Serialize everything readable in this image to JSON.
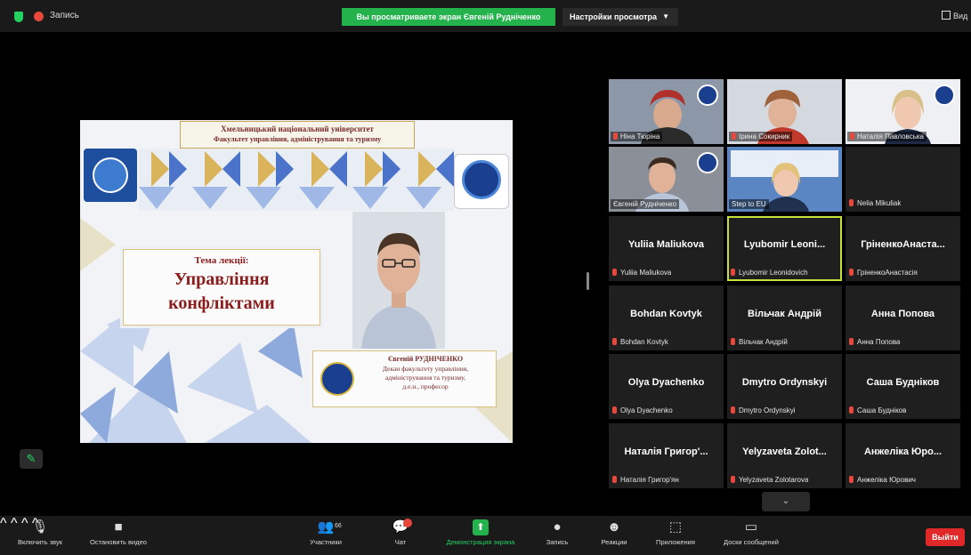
{
  "topbar": {
    "recording_label": "Запись",
    "viewing_banner": "Вы просматриваете экран Євгеній Рудніченко",
    "view_settings_label": "Настройки просмотра",
    "view_button_label": "Вид"
  },
  "slide": {
    "university": "Хмельницький національний університет",
    "faculty": "Факультет управління, адміністрування та туризму",
    "lecture_topic_label": "Тема лекції:",
    "lecture_title_line1": "Управління",
    "lecture_title_line2": "конфліктами",
    "lecturer_name": "Євгеній РУДНІЧЕНКО",
    "lecturer_role_line1": "Декан факультету управління,",
    "lecturer_role_line2": "адміністрування та туризму,",
    "lecturer_role_line3": "д.е.н., професор"
  },
  "gallery": {
    "video_tiles": [
      {
        "label": "Ніна Тюріна"
      },
      {
        "label": "Ірина Сокирник"
      },
      {
        "label": "Наталія Павловська"
      },
      {
        "label": "Євгеній Рудніченко"
      },
      {
        "label": "Step to EU"
      },
      {
        "label": "Nelia Mikuliak"
      }
    ],
    "name_tiles": [
      {
        "display": "Yuliia Maliukova",
        "label": "Yuliia Maliukova"
      },
      {
        "display": "Lyubomir Leoni...",
        "label": "Lyubomir Leonidovich"
      },
      {
        "display": "ГріненкоАнаста...",
        "label": "ГріненкоАнастасія"
      },
      {
        "display": "Bohdan Kovtyk",
        "label": "Bohdan Kovtyk"
      },
      {
        "display": "Вільчак Андрій",
        "label": "Вільчак Андрій"
      },
      {
        "display": "Анна Попова",
        "label": "Анна Попова"
      },
      {
        "display": "Olya Dyachenko",
        "label": "Olya Dyachenko"
      },
      {
        "display": "Dmytro Ordynskyi",
        "label": "Dmytro Ordynskyi"
      },
      {
        "display": "Саша Будніков",
        "label": "Саша Будніков"
      },
      {
        "display": "Наталія Григор'...",
        "label": "Наталія Григор'ян"
      },
      {
        "display": "Yelyzaveta Zolot...",
        "label": "Yelyzaveta Zolotarova"
      },
      {
        "display": "Анжеліка Юро...",
        "label": "Анжеліка Юрович"
      }
    ]
  },
  "toolbar": {
    "unmute": "Включить звук",
    "stop_video": "Остановить видео",
    "participants": "Участники",
    "participants_count": "66",
    "chat": "Чат",
    "share_screen": "Демонстрация экрана",
    "record": "Запись",
    "reactions": "Реакции",
    "apps": "Приложения",
    "whiteboards": "Доски сообщений",
    "leave": "Выйти"
  },
  "colors": {
    "accent_green": "#23b24b",
    "leave_red": "#e02828",
    "active_speaker": "#c8e03a",
    "slide_title": "#8b1c1c"
  }
}
